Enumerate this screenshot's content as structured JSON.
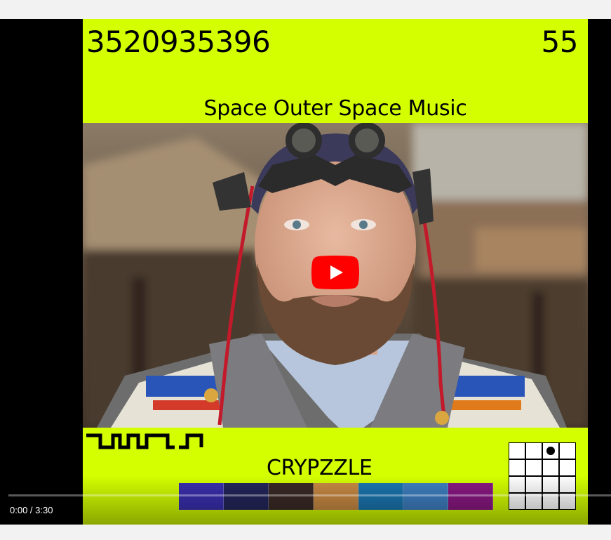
{
  "video": {
    "id_number": "3520935396",
    "count": "55",
    "title": "Space Outer Space Music",
    "brand": "CRYPZZLE",
    "background_color": "#d4ff00",
    "swatches": [
      "#3a2fb0",
      "#23265a",
      "#3a2a26",
      "#c98a44",
      "#1a76b0",
      "#3e7fc2",
      "#8a1782"
    ],
    "puzzle_filled_cell": [
      0,
      2
    ],
    "play_icon": "play-button-icon"
  },
  "player": {
    "time": "0:00 / 3:30",
    "progress": 0
  }
}
